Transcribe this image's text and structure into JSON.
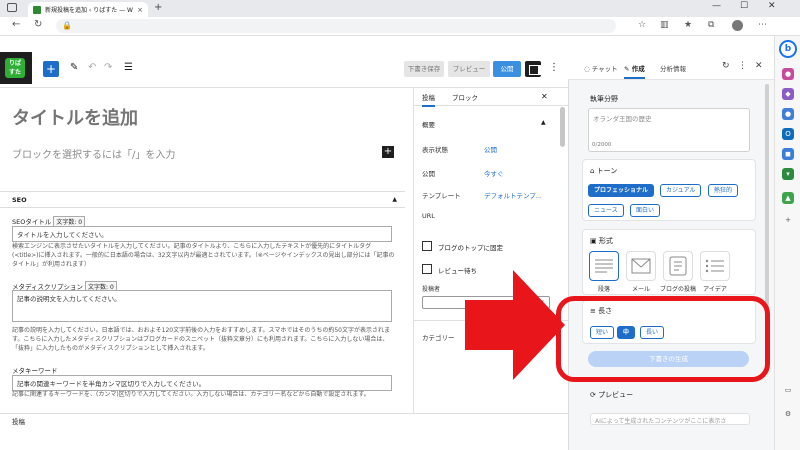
{
  "browser": {
    "tab_title": "新規投稿を追加 ‹ りばすた — Wor",
    "tab_close": "×",
    "new_tab": "+",
    "back": "←",
    "reload": "↻",
    "minimize": "—",
    "maximize": "☐",
    "close": "✕",
    "lock": "🔒"
  },
  "wp_toolbar": {
    "logo_text": "りば\nすた",
    "add": "+",
    "edit": "✎",
    "undo": "↶",
    "redo": "↷",
    "list_view": "☰",
    "draft_label": "下書き保存",
    "preview_label": "プレビュー",
    "publish_label": "公開",
    "more": "⋮"
  },
  "editor": {
    "title_placeholder": "タイトルを追加",
    "block_hint": "ブロックを選択するには「/」を入力",
    "block_plus": "+"
  },
  "seo": {
    "heading": "SEO",
    "caret": "▲",
    "title_label": "SEOタイトル",
    "title_count": "文字数: 0",
    "title_placeholder": "タイトルを入力してください。",
    "title_help": "検索エンジンに表示させたいタイトルを入力してください。記事のタイトルより、こちらに入力したテキストが優先的にタイトルタグ(<title>)に挿入されます。一般的に日本語の場合は、32文字以内が最適とされています。（※ページやインデックスの見出し部分には「記事のタイトル」が利用されます）",
    "desc_label": "メタディスクリプション",
    "desc_count": "文字数: 0",
    "desc_placeholder": "記事の説明文を入力してください。",
    "desc_help": "記事の説明を入力してください。日本語では、おおよそ120文字前後の入力をおすすめします。スマホではそのうちの約50文字が表示されます。こちらに入力したメタディスクリプションはブログカードのスニペット（抜粋文章分）にも利用されます。こちらに入力しない場合は、「抜粋」に入力したものがメタディスクリプションとして挿入されます。",
    "kw_label": "メタキーワード",
    "kw_placeholder": "記事の関連キーワードを半角カンマ区切りで入力してください。",
    "kw_help": "記事に関連するキーワードを、(カンマ)区切りで入力してください。入力しない場合は、カテゴリー名などから自動で設定されます。"
  },
  "status_bar": "投稿",
  "settings": {
    "tab_post": "投稿",
    "tab_block": "ブロック",
    "close": "✕",
    "summary_title": "概要",
    "caret_up": "▲",
    "visibility_label": "表示状態",
    "visibility_value": "公開",
    "publish_label": "公開",
    "publish_value": "今すぐ",
    "template_label": "テンプレート",
    "template_value": "デフォルトテンプ...",
    "url_label": "URL",
    "sticky_label": "ブログのトップに固定",
    "pending_label": "レビュー待ち",
    "author_label": "投稿者",
    "category_label": "カテゴリー"
  },
  "copilot": {
    "tab_chat": "チャット",
    "tab_compose": "作成",
    "tab_insights": "分析情報",
    "refresh": "↻",
    "open": "⧉",
    "more": "⋮",
    "close": "✕",
    "topic_label": "執筆分野",
    "topic_placeholder": "オランダ王国の歴史",
    "counter": "0/2000",
    "tone_label": "トーン",
    "tones": [
      "プロフェッショナル",
      "カジュアル",
      "熱狂的",
      "ニュース",
      "面白い"
    ],
    "format_label": "形式",
    "formats": [
      "段落",
      "メール",
      "ブログの投稿",
      "アイデア"
    ],
    "length_label": "長さ",
    "lengths": [
      "短い",
      "中",
      "長い"
    ],
    "generate_label": "下書きの生成",
    "preview_label": "プレビュー",
    "preview_hint": "AIによって生成されたコンテンツがここに表示さ"
  },
  "colors": {
    "accent": "#1e6dc9",
    "highlight": "#e8161b",
    "publish": "#3b8fe0"
  }
}
